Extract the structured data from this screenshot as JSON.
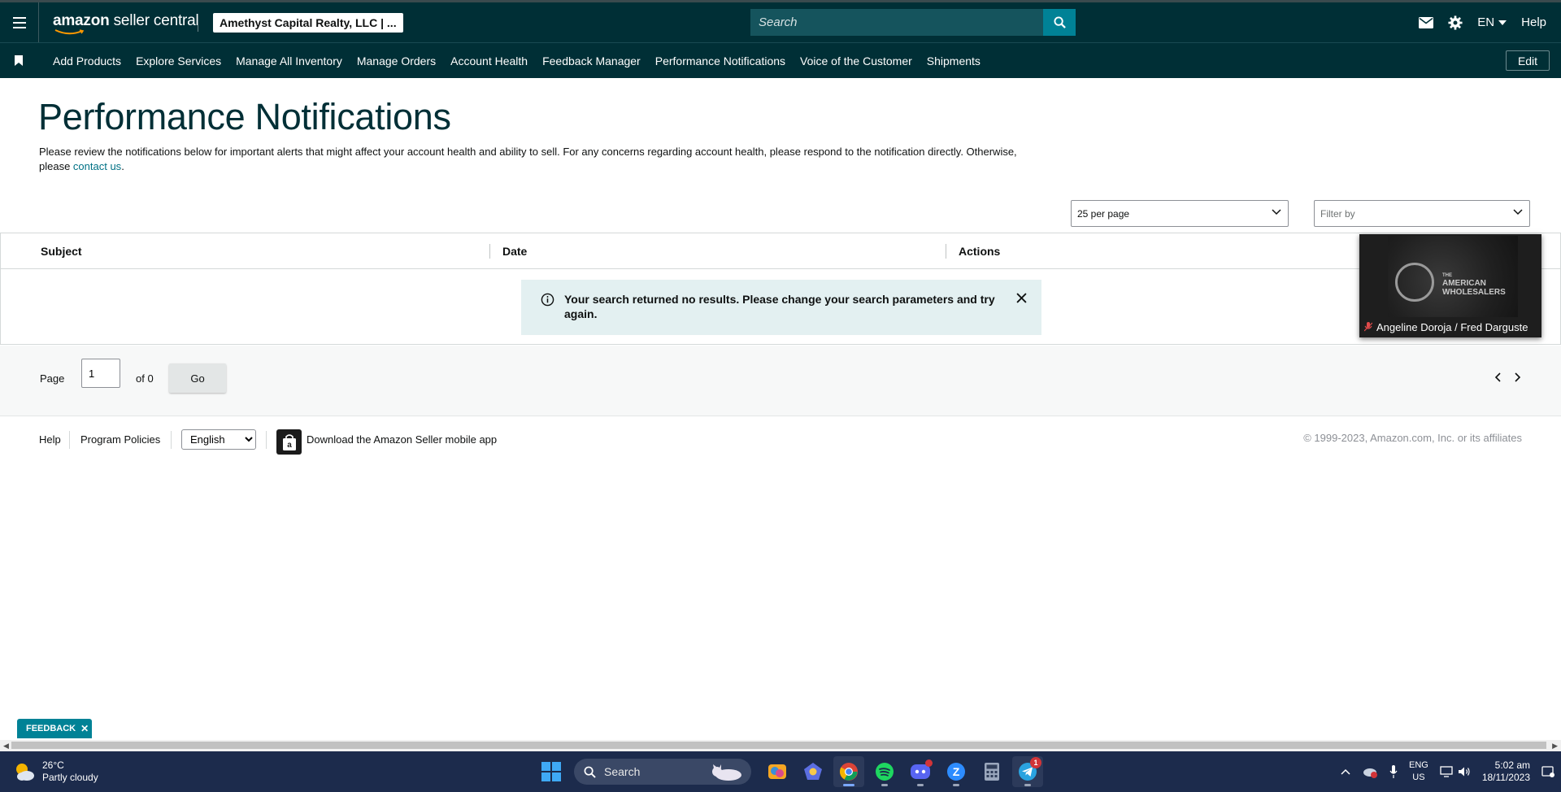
{
  "header": {
    "logo_brand": "amazon",
    "logo_suffix": " seller central",
    "account_selector": "Amethyst Capital Realty, LLC | ...",
    "search_placeholder": "Search",
    "language": "EN",
    "help": "Help"
  },
  "nav": {
    "links": [
      "Add Products",
      "Explore Services",
      "Manage All Inventory",
      "Manage Orders",
      "Account Health",
      "Feedback Manager",
      "Performance Notifications",
      "Voice of the Customer",
      "Shipments"
    ],
    "edit": "Edit"
  },
  "page": {
    "title": "Performance Notifications",
    "intro": "Please review the notifications below for important alerts that might affect your account health and ability to sell. For any concerns regarding account health, please respond to the notification directly. Otherwise, please ",
    "contact_link": "contact us",
    "intro_end": "."
  },
  "controls": {
    "per_page": "25 per page",
    "filter_placeholder": "Filter by"
  },
  "table": {
    "columns": [
      "Subject",
      "Date",
      "Actions"
    ],
    "empty_message": "Your search returned no results. Please change your search parameters and try again."
  },
  "video_overlay": {
    "brand_small": "THE",
    "brand_line1": "AMERICAN",
    "brand_line2": "WHOLESALERS",
    "caption": "Angeline Doroja / Fred Darguste"
  },
  "pagination": {
    "page_label": "Page",
    "page_value": "1",
    "of_label": "of 0",
    "go": "Go"
  },
  "footer": {
    "help": "Help",
    "program_policies": "Program Policies",
    "language": "English",
    "download_app": "Download the Amazon Seller mobile app",
    "copyright": "© 1999-2023, Amazon.com, Inc. or its affiliates"
  },
  "feedback_tab": "FEEDBACK",
  "taskbar": {
    "temperature": "26°C",
    "weather": "Partly cloudy",
    "search": "Search",
    "telegram_badge": "1",
    "lang_top": "ENG",
    "lang_bottom": "US",
    "time": "5:02 am",
    "date": "18/11/2023"
  },
  "colors": {
    "header_bg": "#002f36",
    "accent_teal": "#008296",
    "link": "#007185",
    "alert_bg": "#e3f0f1",
    "taskbar_bg": "#1c2b4c"
  }
}
